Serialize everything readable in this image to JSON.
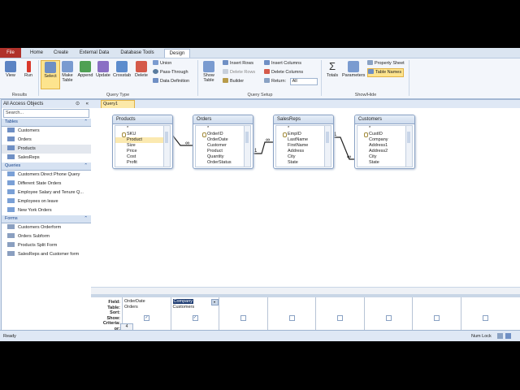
{
  "tabs": [
    "File",
    "Home",
    "Create",
    "External Data",
    "Database Tools",
    "Design"
  ],
  "ribbon": {
    "results": {
      "view": "View",
      "run": "Run",
      "label": "Results"
    },
    "query_type": {
      "select": "Select",
      "make_table": "Make Table",
      "append": "Append",
      "update": "Update",
      "crosstab": "Crosstab",
      "delete": "Delete",
      "union": "Union",
      "pass_through": "Pass-Through",
      "data_definition": "Data Definition",
      "label": "Query Type"
    },
    "query_setup": {
      "show_table": "Show Table",
      "insert_rows": "Insert Rows",
      "delete_rows": "Delete Rows",
      "builder": "Builder",
      "insert_columns": "Insert Columns",
      "delete_columns": "Delete Columns",
      "return_label": "Return:",
      "return_value": "All",
      "label": "Query Setup"
    },
    "show_hide": {
      "totals": "Totals",
      "parameters": "Parameters",
      "property_sheet": "Property Sheet",
      "table_names": "Table Names",
      "label": "Show/Hide"
    }
  },
  "nav": {
    "title": "All Access Objects",
    "search_placeholder": "Search...",
    "categories": [
      {
        "name": "Tables",
        "items": [
          "Customers",
          "Orders",
          "Products",
          "SalesReps"
        ]
      },
      {
        "name": "Queries",
        "items": [
          "Customers Direct Phone Query",
          "Different State Orders",
          "Employee Salary and Tenure Q...",
          "Employees on leave",
          "New York Orders"
        ]
      },
      {
        "name": "Forms",
        "items": [
          "Customers Orderform",
          "Orders Subform",
          "Products Split Form",
          "SalesReps and Customer form"
        ]
      }
    ]
  },
  "doc_tab": "Query1",
  "tables": [
    {
      "name": "Products",
      "fields": [
        "*",
        "SKU",
        "Product",
        "Size",
        "Price",
        "Cost",
        "Profit"
      ]
    },
    {
      "name": "Orders",
      "fields": [
        "*",
        "OrderID",
        "OrderDate",
        "Customer",
        "Product",
        "Quantity",
        "OrderStatus"
      ]
    },
    {
      "name": "SalesReps",
      "fields": [
        "*",
        "EmpID",
        "LastName",
        "FirstName",
        "Address",
        "City",
        "State"
      ]
    },
    {
      "name": "Customers",
      "fields": [
        "*",
        "CustID",
        "Company",
        "Address1",
        "Address2",
        "City",
        "State"
      ]
    }
  ],
  "join_labels": {
    "one": "1",
    "many": "∞"
  },
  "grid": {
    "row_labels": [
      "Field:",
      "Table:",
      "Sort:",
      "Show:",
      "Criteria:",
      "or:"
    ],
    "columns": [
      {
        "field": "OrderDate",
        "table": "Orders"
      },
      {
        "field": "Company",
        "table": "Customers"
      }
    ],
    "check_mark": "✓",
    "nav_text": "4"
  },
  "status": {
    "left": "Ready",
    "right": "Num Lock"
  },
  "colors": {
    "accent": "#b0322b",
    "selection": "#fde48e"
  }
}
